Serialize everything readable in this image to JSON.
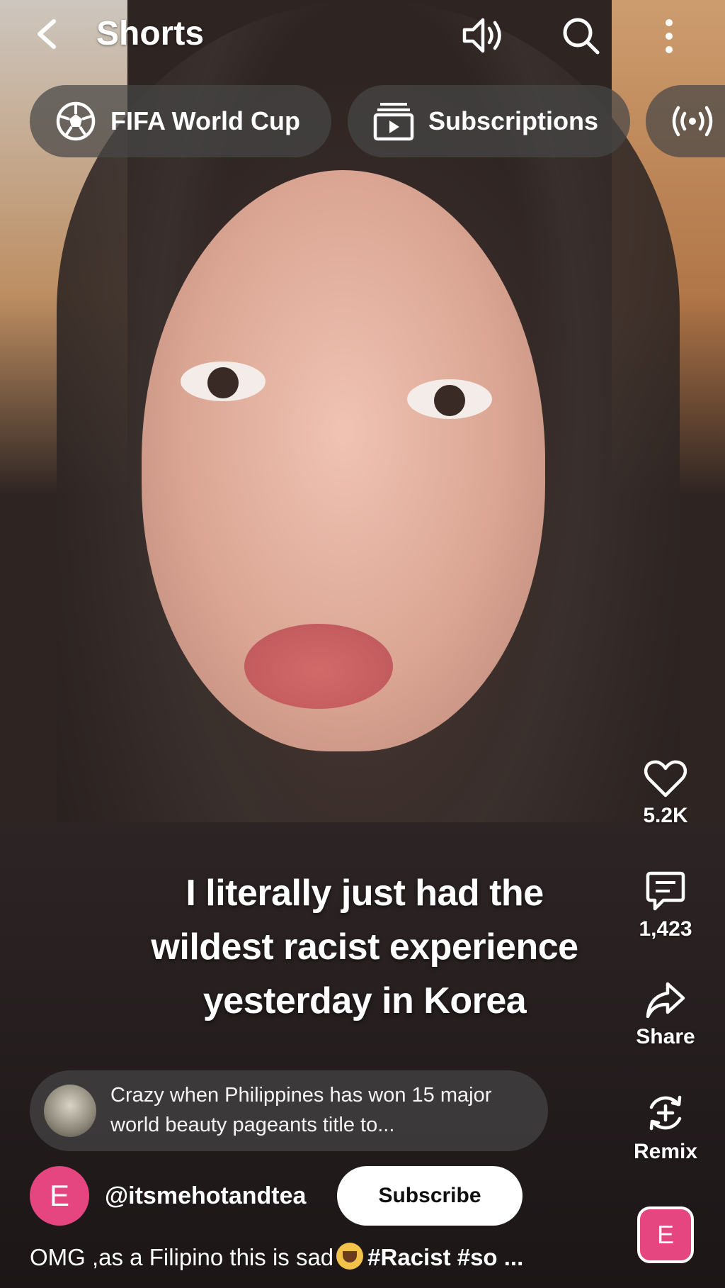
{
  "header": {
    "title": "Shorts"
  },
  "chips": [
    {
      "label": "FIFA World Cup",
      "icon": "soccer-ball-icon"
    },
    {
      "label": "Subscriptions",
      "icon": "subscriptions-icon"
    },
    {
      "label": "",
      "icon": "live-broadcast-icon"
    }
  ],
  "actions": {
    "likes": "5.2K",
    "comments": "1,423",
    "share": "Share",
    "remix": "Remix"
  },
  "video": {
    "caption_lines": [
      "I literally just had the",
      "wildest racist experience",
      "yesterday in Korea"
    ]
  },
  "top_comment": {
    "text": "Crazy when Philippines has won 15 major world beauty pageants title to..."
  },
  "channel": {
    "avatar_letter": "E",
    "handle": "@itsmehotandtea",
    "subscribe_label": "Subscribe"
  },
  "description": {
    "text": "OMG ,as a Filipino this is sad",
    "tags": "#Racist #so ..."
  },
  "sound": {
    "badge_letter": "E"
  },
  "colors": {
    "avatar": "#e6467f",
    "chip_bg": "#464646"
  }
}
